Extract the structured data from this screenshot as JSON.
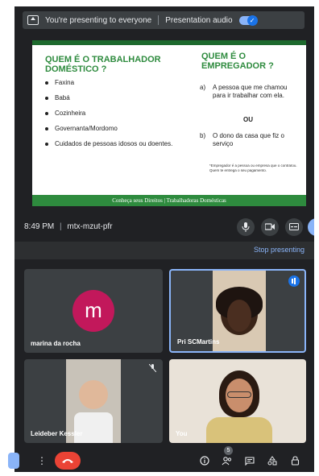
{
  "banner": {
    "presenting_text": "You're presenting to everyone",
    "audio_label": "Presentation audio",
    "audio_toggle_glyph": "✓"
  },
  "slide": {
    "left_title": "QUEM É O TRABALHADOR DOMÉSTICO ?",
    "right_title": "QUEM É O EMPREGADOR ?",
    "items": [
      "Faxina",
      "Babá",
      "Cozinheira",
      "Governanta/Mordomo",
      "Cuidados de pessoas idosos ou doentes."
    ],
    "option_a_marker": "a)",
    "option_a_text": "A pessoa que me chamou para ir trabalhar com ela.",
    "or_text": "OU",
    "option_b_marker": "b)",
    "option_b_text": "O dono da casa que fiz o serviço",
    "note": "*Empregador é a pessoa ou empresa que o contratou. Quem te entrega o seu pagamento.",
    "footer": "Conheça seus Direitos | Trabalhadoras Domésticas"
  },
  "meeting": {
    "time": "8:49 PM",
    "separator": "|",
    "code": "mtx-mzut-pfr"
  },
  "stop_presenting": "Stop presenting",
  "participants": [
    {
      "name": "marina da rocha",
      "initial": "m"
    },
    {
      "name": "Pri SCMartins"
    },
    {
      "name": "Leideber Kessler"
    },
    {
      "name": "You"
    }
  ],
  "bottom": {
    "people_count": "5"
  },
  "colors": {
    "meet_bg": "#202124",
    "tile_bg": "#3c4043",
    "accent_blue": "#8ab4f8",
    "slide_green": "#2e8b3e",
    "hangup_red": "#ea4335",
    "avatar_pink": "#c2185b"
  },
  "icons": [
    "present-screen-icon",
    "audio-toggle-icon",
    "mic-icon",
    "camera-icon",
    "captions-icon",
    "present-now-icon",
    "more-options-icon",
    "hangup-icon",
    "info-icon",
    "people-icon",
    "chat-icon",
    "activities-icon",
    "lock-icon",
    "muted-mic-icon",
    "speaking-indicator-icon"
  ]
}
